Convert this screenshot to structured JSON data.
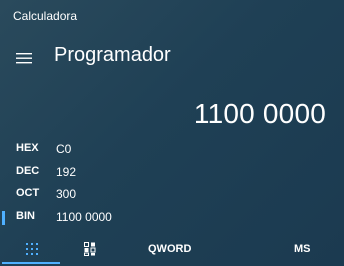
{
  "window": {
    "title": "Calculadora"
  },
  "header": {
    "menu_icon": "hamburger-icon",
    "mode": "Programador"
  },
  "display": {
    "value": "1100 0000"
  },
  "radix": [
    {
      "label": "HEX",
      "value": "C0",
      "selected": false
    },
    {
      "label": "DEC",
      "value": "192",
      "selected": false
    },
    {
      "label": "OCT",
      "value": "300",
      "selected": false
    },
    {
      "label": "BIN",
      "value": "1100 0000",
      "selected": true
    }
  ],
  "bottom_bar": {
    "keypad_icon": "keypad-grid-icon",
    "bitpad_icon": "bit-toggle-icon",
    "word_size": "QWORD",
    "memory_store": "MS"
  },
  "colors": {
    "accent": "#4fb0ff",
    "background": "#1f4055",
    "text": "#ffffff"
  }
}
